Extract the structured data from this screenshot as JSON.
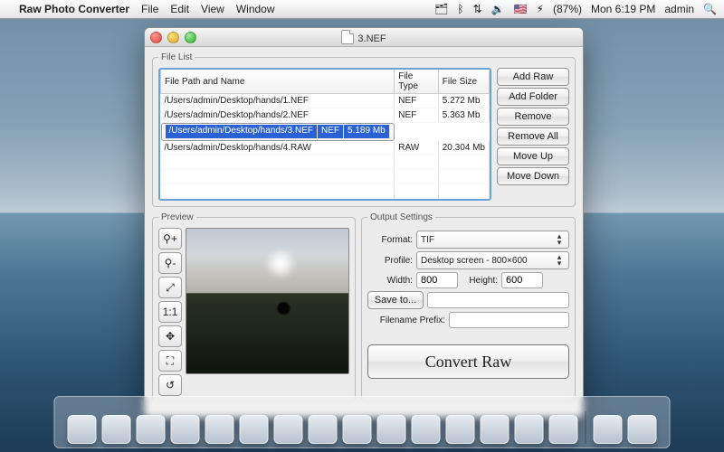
{
  "menubar": {
    "apple": "",
    "app": "Raw Photo Converter",
    "menus": [
      "File",
      "Edit",
      "View",
      "Window"
    ],
    "status_icons": [
      "🗂",
      "ᛒ",
      "⇅",
      "🔉",
      "🇺🇸",
      "⚡︎"
    ],
    "battery": "(87%)",
    "clock": "Mon 6:19 PM",
    "user": "admin",
    "spotlight": "🔍"
  },
  "window": {
    "title": "3.NEF"
  },
  "filelist": {
    "legend": "File List",
    "columns": [
      "File Path and Name",
      "File Type",
      "File Size"
    ],
    "rows": [
      {
        "path": "/Users/admin/Desktop/hands/1.NEF",
        "type": "NEF",
        "size": "5.272 Mb",
        "selected": false
      },
      {
        "path": "/Users/admin/Desktop/hands/2.NEF",
        "type": "NEF",
        "size": "5.363 Mb",
        "selected": false
      },
      {
        "path": "/Users/admin/Desktop/hands/3.NEF",
        "type": "NEF",
        "size": "5.189 Mb",
        "selected": true
      },
      {
        "path": "/Users/admin/Desktop/hands/4.RAW",
        "type": "RAW",
        "size": "20.304 Mb",
        "selected": false
      }
    ],
    "buttons": [
      "Add Raw",
      "Add Folder",
      "Remove",
      "Remove All",
      "Move Up",
      "Move Down"
    ]
  },
  "preview": {
    "legend": "Preview",
    "tool_icons": [
      "zoom-in-icon",
      "zoom-out-icon",
      "fit-icon",
      "actual-size-icon",
      "pan-icon",
      "fullscreen-icon",
      "reset-icon"
    ],
    "tool_glyphs": [
      "⚲+",
      "⚲-",
      "⤢",
      "1:1",
      "✥",
      "⛶",
      "↺"
    ]
  },
  "output": {
    "legend": "Output Settings",
    "format_label": "Format:",
    "format_value": "TIF",
    "profile_label": "Profile:",
    "profile_value": "Desktop screen - 800×600",
    "width_label": "Width:",
    "width_value": "800",
    "height_label": "Height:",
    "height_value": "600",
    "saveto_label": "Save to...",
    "saveto_value": "",
    "prefix_label": "Filename Prefix:",
    "prefix_value": "",
    "convert_label": "Convert Raw"
  }
}
